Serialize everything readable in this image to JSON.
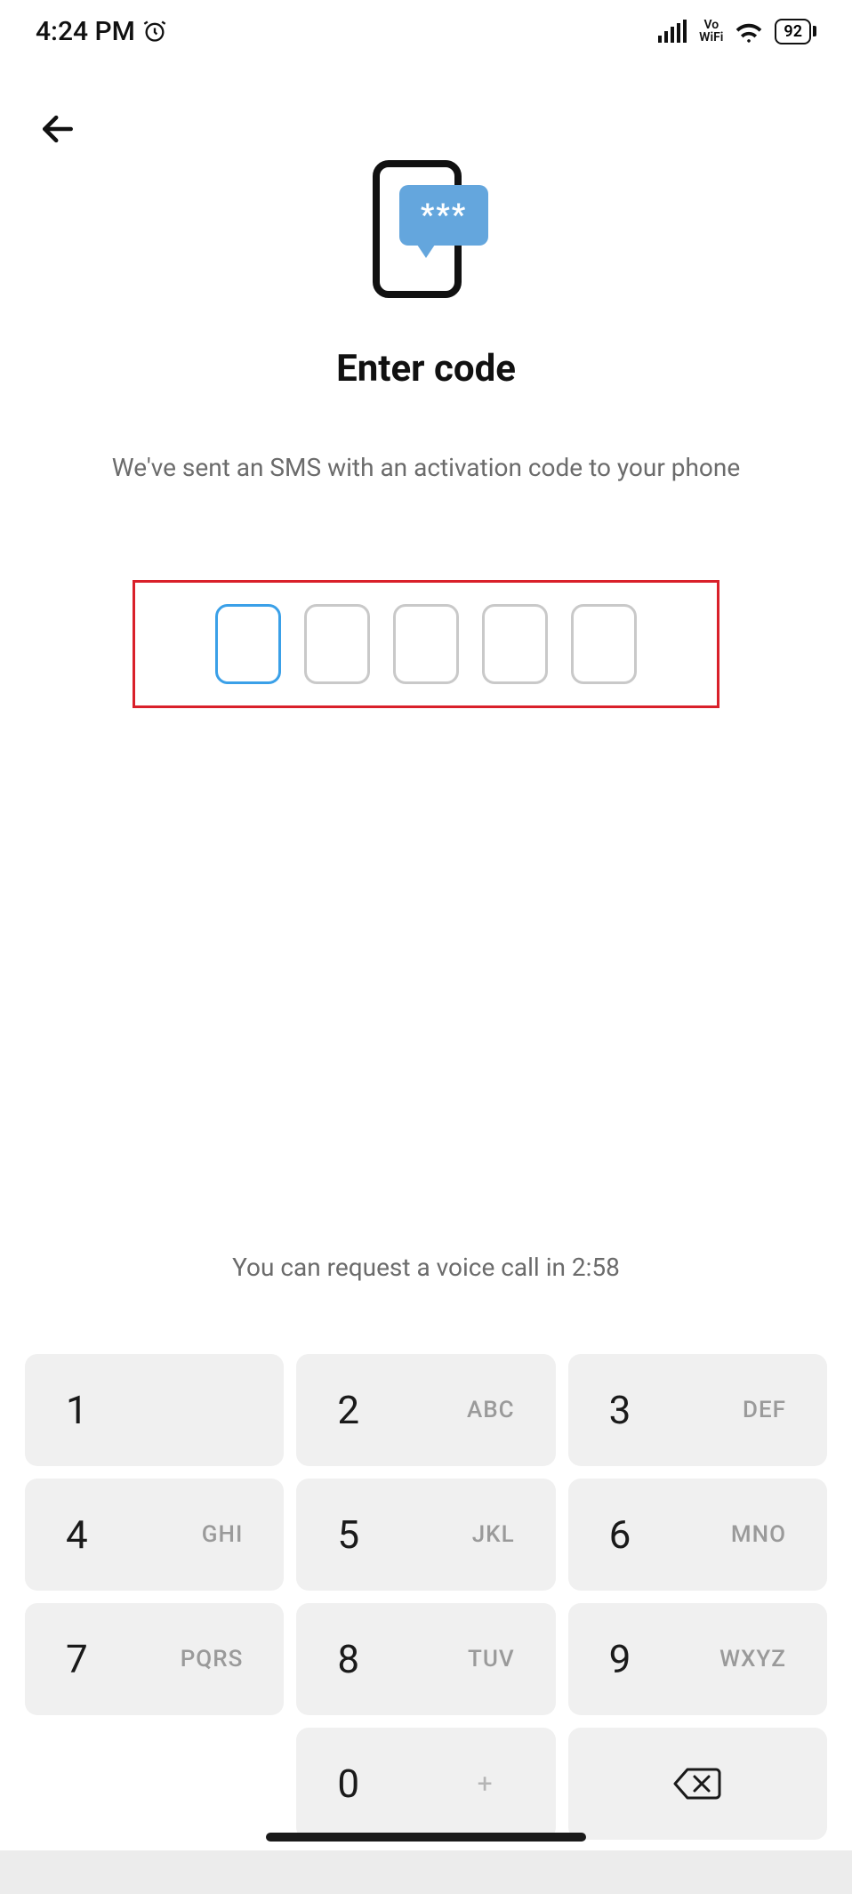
{
  "status": {
    "time": "4:24 PM",
    "vowifi_top": "Vo",
    "vowifi_bottom": "WiFi",
    "battery": "92"
  },
  "hero": {
    "stars": "***",
    "title": "Enter code",
    "subtitle": "We've sent an SMS with an activation code to your phone"
  },
  "code": {
    "digits": [
      "",
      "",
      "",
      "",
      ""
    ],
    "active_index": 0
  },
  "voice_call_line": "You can request a voice call in 2:58",
  "keypad": {
    "keys": [
      {
        "digit": "1",
        "letters": ""
      },
      {
        "digit": "2",
        "letters": "ABC"
      },
      {
        "digit": "3",
        "letters": "DEF"
      },
      {
        "digit": "4",
        "letters": "GHI"
      },
      {
        "digit": "5",
        "letters": "JKL"
      },
      {
        "digit": "6",
        "letters": "MNO"
      },
      {
        "digit": "7",
        "letters": "PQRS"
      },
      {
        "digit": "8",
        "letters": "TUV"
      },
      {
        "digit": "9",
        "letters": "WXYZ"
      }
    ],
    "zero": {
      "digit": "0",
      "letters": "+"
    }
  }
}
